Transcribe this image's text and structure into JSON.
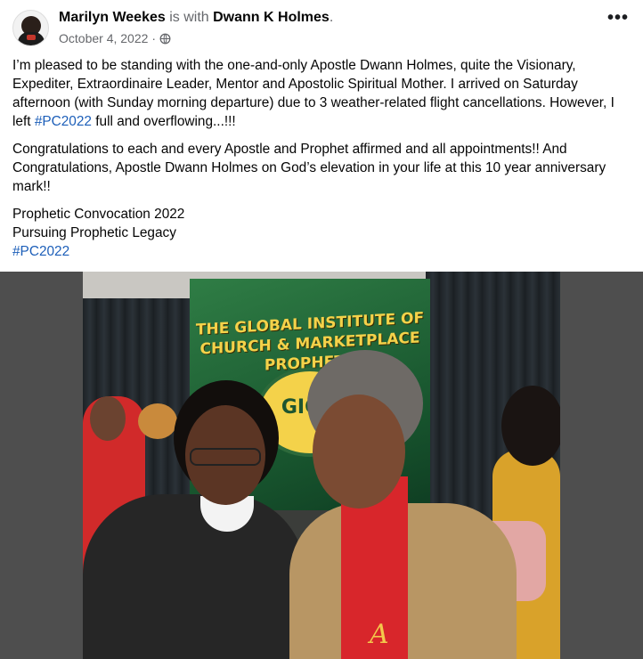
{
  "post": {
    "author": "Marilyn Weekes",
    "with_text": "is with",
    "tagged": "Dwann K Holmes",
    "tagged_suffix": ".",
    "date": "October 4, 2022",
    "separator": "·",
    "privacy_icon": "globe-icon",
    "more_icon": "more-options-icon",
    "more_label": "•••"
  },
  "body": {
    "p1_text": "I’m pleased to be standing with the one-and-only Apostle Dwann Holmes, quite the Visionary, Expediter, Extraordinaire Leader, Mentor and Apostolic Spiritual Mother. I arrived on Saturday afternoon (with Sunday morning departure) due to 3 weather-related flight cancellations. However, I left ",
    "p1_hashtag": "#PC2022",
    "p1_tail": " full and overflowing...!!!",
    "p2": "Congratulations to each and every Apostle and Prophet affirmed and all appointments!! And Congratulations, Apostle Dwann Holmes on God’s elevation in your life at this 10 year anniversary mark!!",
    "line1": "Prophetic Convocation 2022",
    "line2": "Pursuing Prophetic Legacy",
    "hashtag": "#PC2022"
  },
  "photo": {
    "banner_line1": "THE GLOBAL INSTITUTE OF",
    "banner_line2": "CHURCH & MARKETPLACE PROPHETS",
    "banner_logo": "GICM",
    "stole_letter": "A"
  },
  "colors": {
    "link": "#1d5fb9",
    "secondary_text": "#65676b",
    "banner_green": "#17532d",
    "banner_gold": "#f4d24a",
    "stole_red": "#d8262b"
  }
}
